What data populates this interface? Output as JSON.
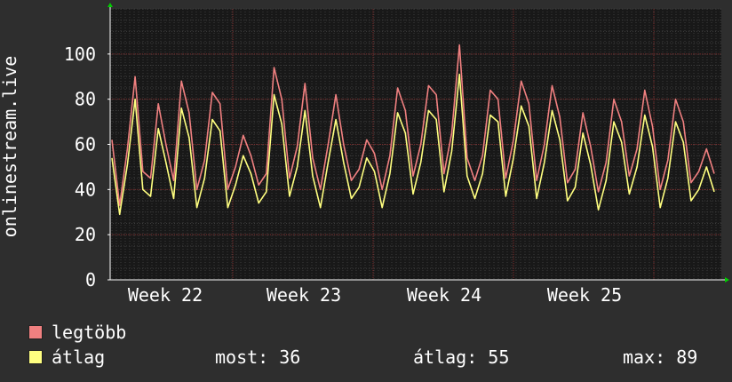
{
  "chart_data": {
    "type": "line",
    "ylabel": "onlinestream.live",
    "ylim": [
      0,
      120
    ],
    "yticks": [
      0,
      20,
      40,
      60,
      80,
      100
    ],
    "x_tick_labels": [
      "Week 22",
      "Week 23",
      "Week 24",
      "Week 25"
    ],
    "grid": true,
    "series": [
      {
        "name": "legtöbb",
        "color": "#f08080",
        "values": [
          62,
          33,
          58,
          90,
          48,
          45,
          78,
          60,
          44,
          88,
          74,
          40,
          53,
          83,
          78,
          40,
          50,
          64,
          55,
          42,
          47,
          94,
          80,
          45,
          59,
          87,
          54,
          40,
          60,
          82,
          60,
          44,
          49,
          62,
          56,
          40,
          55,
          85,
          75,
          46,
          60,
          86,
          82,
          47,
          65,
          104,
          54,
          44,
          55,
          84,
          80,
          45,
          62,
          88,
          78,
          44,
          60,
          86,
          72,
          43,
          49,
          74,
          59,
          39,
          52,
          80,
          70,
          46,
          58,
          84,
          68,
          40,
          53,
          80,
          70,
          43,
          48,
          58,
          47
        ]
      },
      {
        "name": "átlag",
        "color": "#ffff80",
        "values": [
          54,
          29,
          51,
          80,
          40,
          37,
          67,
          52,
          36,
          76,
          63,
          32,
          45,
          71,
          66,
          32,
          42,
          55,
          47,
          34,
          39,
          82,
          69,
          37,
          50,
          75,
          46,
          32,
          52,
          71,
          52,
          36,
          41,
          54,
          48,
          32,
          47,
          74,
          65,
          38,
          52,
          75,
          71,
          39,
          57,
          91,
          46,
          36,
          47,
          73,
          70,
          37,
          54,
          77,
          68,
          36,
          52,
          75,
          62,
          35,
          41,
          65,
          51,
          31,
          44,
          70,
          61,
          38,
          50,
          73,
          59,
          32,
          45,
          70,
          61,
          35,
          40,
          50,
          39
        ]
      }
    ]
  },
  "legend": {
    "max_label": "legtöbb",
    "avg_label": "átlag",
    "now": "most: 36",
    "average": "átlag: 55",
    "maximum": "max: 89"
  },
  "colors": {
    "background": "#2e2e2e",
    "plot": "#181818",
    "grid_minor": "#3c3c3c",
    "grid_major": "#7a2a2a",
    "axis": "#ffffff",
    "arrow": "#00cc00"
  }
}
